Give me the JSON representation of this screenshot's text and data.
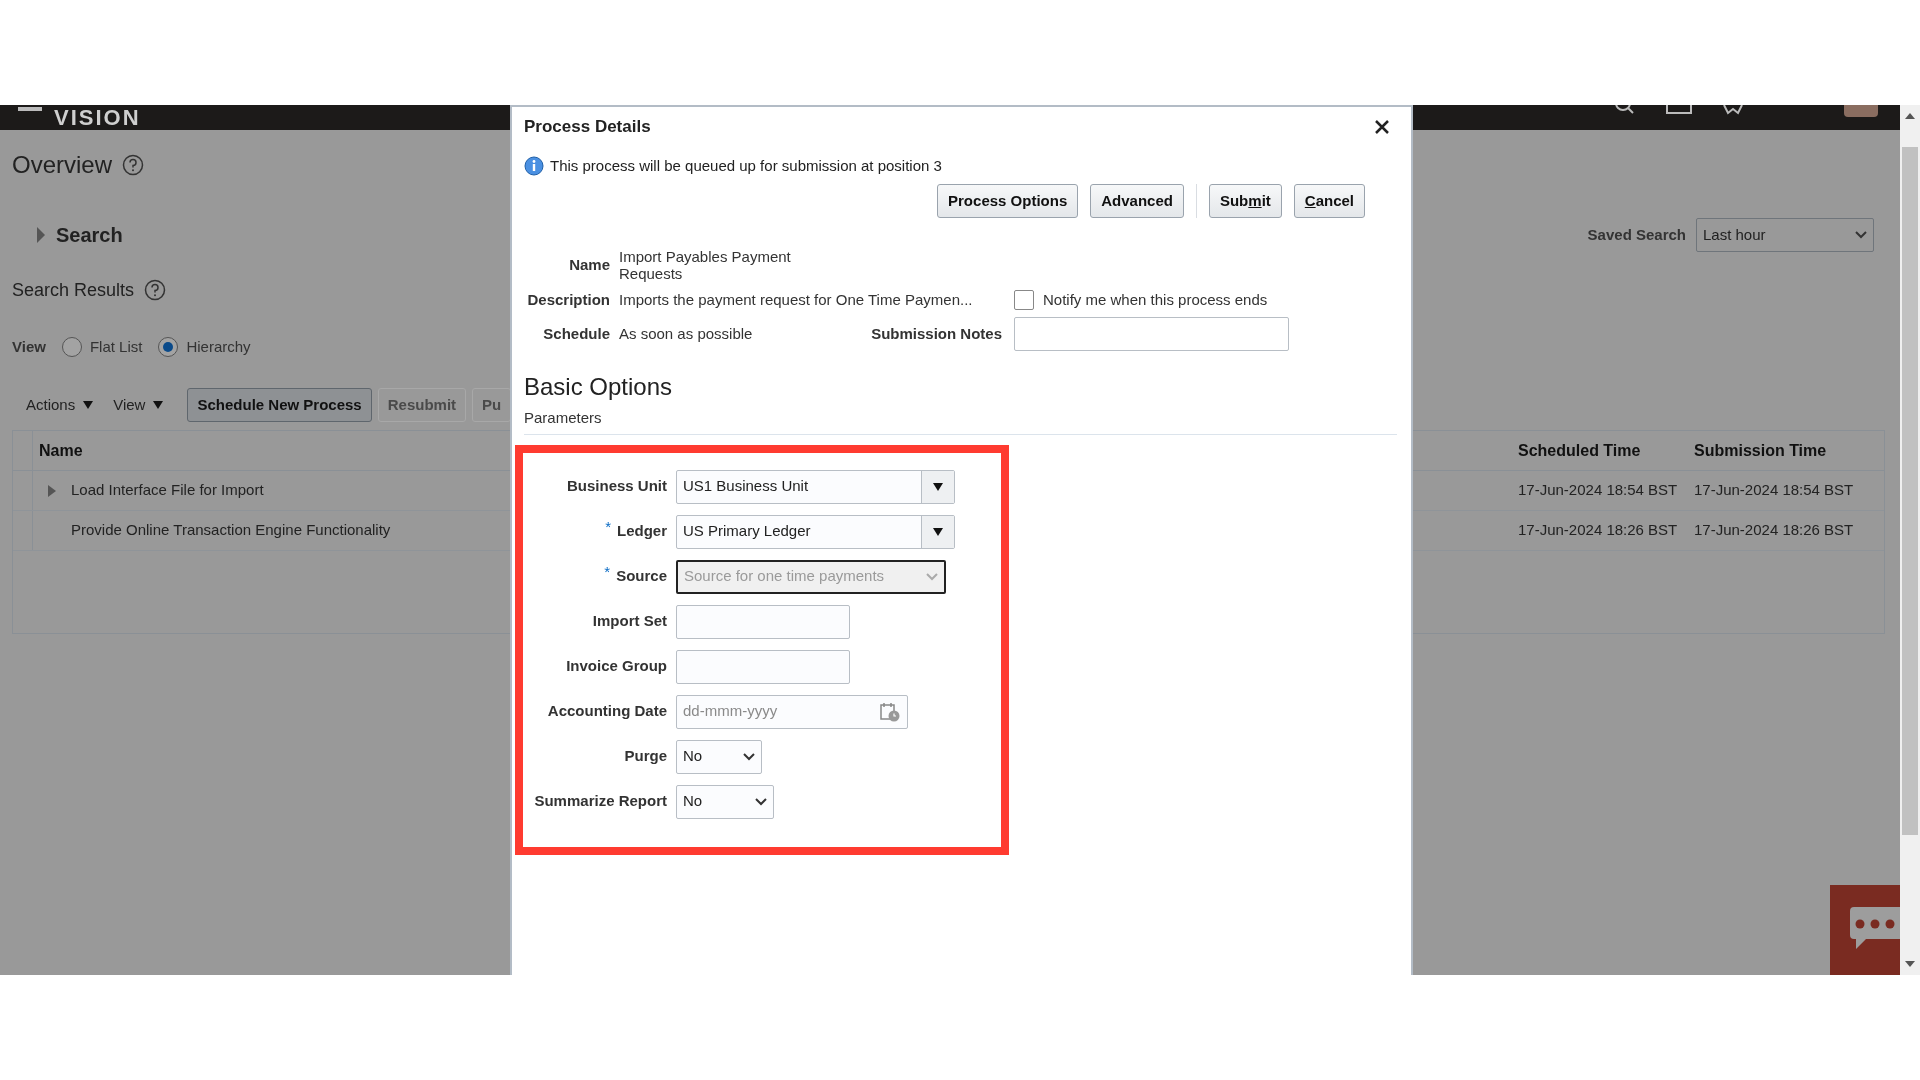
{
  "header": {
    "logo": "VISION"
  },
  "page": {
    "title": "Overview",
    "search": {
      "label": "Search",
      "expanded": false
    },
    "results_title": "Search Results",
    "view": {
      "label": "View",
      "options": [
        {
          "label": "Flat List",
          "selected": false
        },
        {
          "label": "Hierarchy",
          "selected": true
        }
      ]
    },
    "toolbar": {
      "menus": [
        "Actions",
        "View"
      ],
      "buttons": [
        {
          "label": "Schedule New Process",
          "disabled": false
        },
        {
          "label": "Resubmit",
          "disabled": true
        },
        {
          "label": "Pu",
          "disabled": true
        }
      ]
    },
    "saved_search": {
      "label": "Saved Search",
      "value": "Last hour"
    },
    "table": {
      "columns": [
        "Name",
        "Scheduled Time",
        "Submission Time"
      ],
      "rows": [
        {
          "name": "Load Interface File for Import",
          "expandable": true,
          "scheduled_time": "17-Jun-2024 18:54 BST",
          "submission_time": "17-Jun-2024 18:54 BST"
        },
        {
          "name": "Provide Online Transaction Engine Functionality",
          "expandable": false,
          "scheduled_time": "17-Jun-2024 18:26 BST",
          "submission_time": "17-Jun-2024 18:26 BST"
        }
      ]
    }
  },
  "dialog": {
    "title": "Process Details",
    "info": "This process will be queued up for submission at position 3",
    "buttons": [
      {
        "parts": [
          {
            "text": "Process Options",
            "access_key": false
          }
        ]
      },
      {
        "parts": [
          {
            "text": "Advanced",
            "access_key": false
          }
        ]
      },
      {
        "parts": [
          {
            "text": "Sub",
            "access_key": false
          },
          {
            "text": "m",
            "access_key": true
          },
          {
            "text": "it",
            "access_key": false
          }
        ]
      },
      {
        "parts": [
          {
            "text": "C",
            "access_key": true
          },
          {
            "text": "ancel",
            "access_key": false
          }
        ]
      }
    ],
    "name_label": "Name",
    "name": "Import Payables Payment Requests",
    "description_label": "Description",
    "description": "Imports the payment request for One Time Paymen...",
    "notify": {
      "label": "Notify me when this process ends",
      "checked": false
    },
    "schedule_label": "Schedule",
    "schedule": "As soon as possible",
    "notes_label": "Submission Notes",
    "section": "Basic Options",
    "subsection": "Parameters",
    "highlighted": true,
    "parameters": [
      {
        "label": "Business Unit",
        "kind": "combo",
        "value": "US1 Business Unit"
      },
      {
        "label": "Ledger",
        "required_mark": "*",
        "kind": "combo",
        "value": "US Primary Ledger"
      },
      {
        "label": "Source",
        "required_mark": "*",
        "kind": "select",
        "placeholder": "Source for one time payments",
        "focused": true
      },
      {
        "label": "Import Set",
        "kind": "text"
      },
      {
        "label": "Invoice Group",
        "kind": "text"
      },
      {
        "label": "Accounting Date",
        "kind": "date",
        "placeholder": "dd-mmm-yyyy"
      },
      {
        "label": "Purge",
        "kind": "select",
        "value": "No",
        "focused": false
      },
      {
        "label": "Summarize Report",
        "kind": "select",
        "value": "No",
        "focused": false
      }
    ]
  }
}
